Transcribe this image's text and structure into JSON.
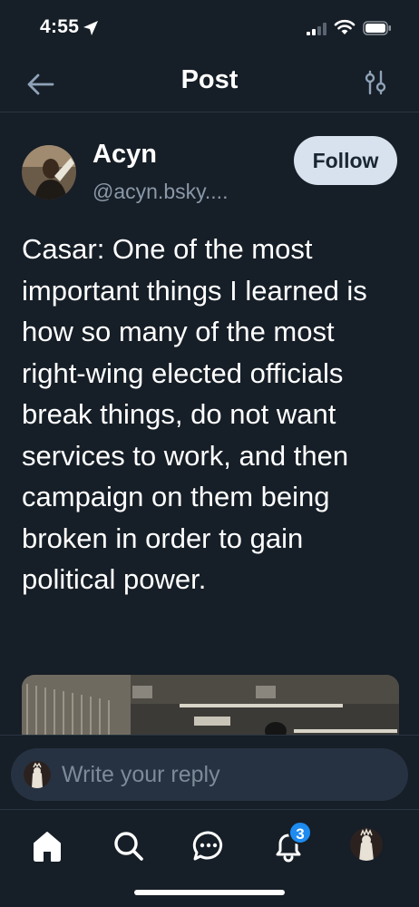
{
  "status_bar": {
    "time": "4:55",
    "icons": [
      "location-arrow-icon",
      "signal-icon",
      "wifi-icon",
      "battery-icon"
    ]
  },
  "header": {
    "title": "Post",
    "back_icon": "arrow-left-icon",
    "filter_icon": "sliders-icon"
  },
  "post": {
    "author_name": "Acyn",
    "author_handle": "@acyn.bsky....",
    "follow_label": "Follow",
    "text": "Casar: One of the most important things I learned is how so many of the most right-wing elected officials break things, do not want services to work, and then campaign on them being broken in order to gain political power."
  },
  "reply": {
    "placeholder": "Write your reply"
  },
  "tab_bar": {
    "tabs": [
      "home-icon",
      "search-icon",
      "chat-icon",
      "notifications-icon",
      "profile-avatar"
    ],
    "notifications_badge": "3"
  },
  "colors": {
    "background": "#161e27",
    "follow_button": "#d8e2ee",
    "badge": "#1d8bf0",
    "secondary_text": "#8a98a8"
  }
}
